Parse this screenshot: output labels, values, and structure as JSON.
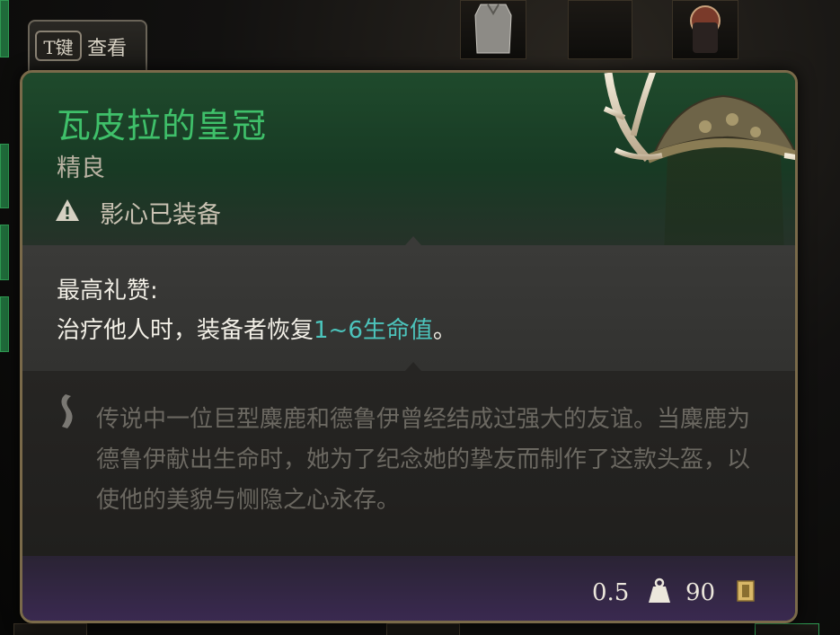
{
  "view_hint": {
    "key": "T键",
    "label": "查看"
  },
  "item": {
    "name": "瓦皮拉的皇冠",
    "rarity": "精良",
    "equipped_by": "影心已装备"
  },
  "ability": {
    "title": "最高礼赞:",
    "desc_before": "治疗他人时，装备者恢复",
    "desc_highlight": "1~6生命值",
    "desc_after": "。"
  },
  "lore": {
    "text": "传说中一位巨型麋鹿和德鲁伊曾经结成过强大的友谊。当麋鹿为德鲁伊献出生命时，她为了纪念她的挚友而制作了这款头盔，以使他的美貌与恻隐之心永存。"
  },
  "footer": {
    "weight": "0.5",
    "price": "90"
  },
  "colors": {
    "rarity_uncommon": "#3fc06a",
    "highlight": "#4cc4bc",
    "footer_purple": "#3b2a52"
  },
  "icons": {
    "warning": "warning-icon",
    "quote": "lore-quote-icon",
    "weight": "weight-icon",
    "gold": "gold-coin-icon"
  }
}
